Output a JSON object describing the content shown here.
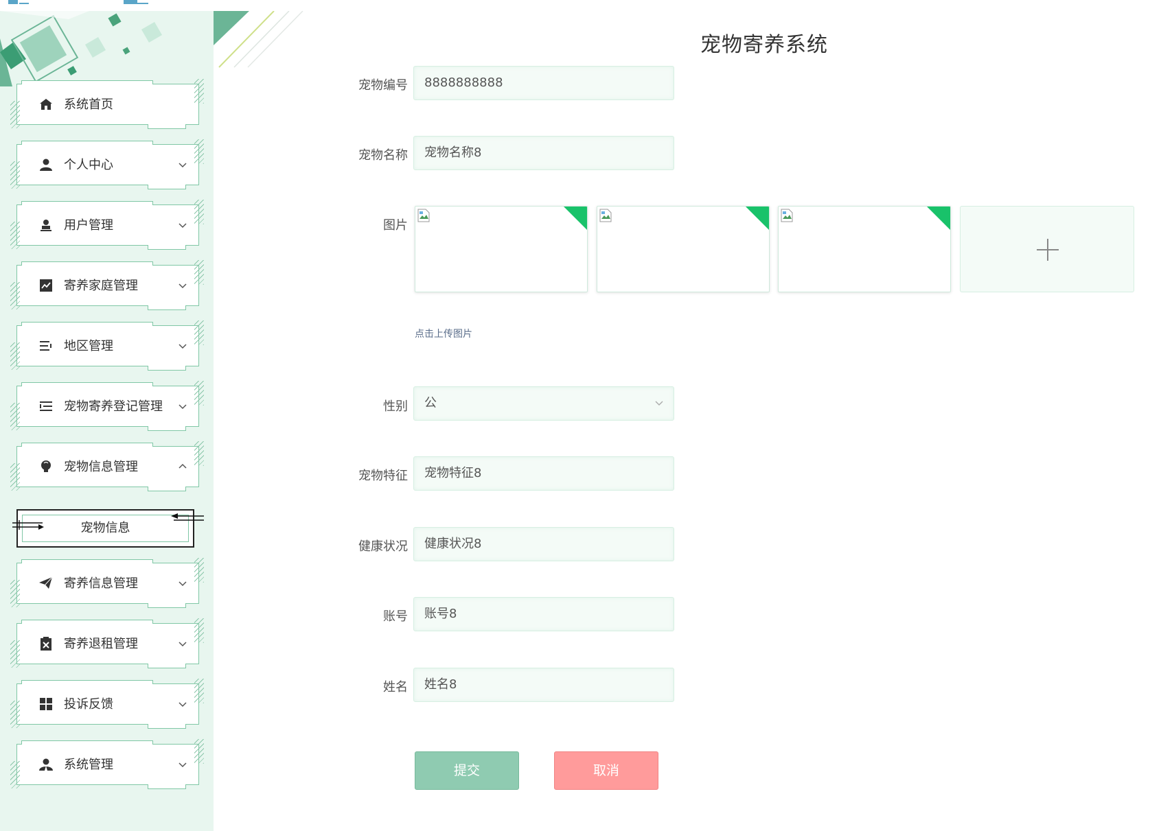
{
  "app": {
    "title": "宠物寄养系统"
  },
  "sidebar": {
    "items": [
      {
        "label": "系统首页",
        "icon": "home-icon",
        "has_chevron": false
      },
      {
        "label": "个人中心",
        "icon": "user-icon",
        "has_chevron": true
      },
      {
        "label": "用户管理",
        "icon": "user-manage-icon",
        "has_chevron": true
      },
      {
        "label": "寄养家庭管理",
        "icon": "chart-icon",
        "has_chevron": true
      },
      {
        "label": "地区管理",
        "icon": "list-indent-icon",
        "has_chevron": true
      },
      {
        "label": "宠物寄养登记管理",
        "icon": "list-outdent-icon",
        "has_chevron": true
      },
      {
        "label": "宠物信息管理",
        "icon": "lightbulb-icon",
        "has_chevron": true,
        "expanded": true
      },
      {
        "label": "寄养信息管理",
        "icon": "paper-plane-icon",
        "has_chevron": true
      },
      {
        "label": "寄养退租管理",
        "icon": "clipboard-x-icon",
        "has_chevron": true
      },
      {
        "label": "投诉反馈",
        "icon": "grid-icon",
        "has_chevron": true
      },
      {
        "label": "系统管理",
        "icon": "admin-user-icon",
        "has_chevron": true
      }
    ],
    "sub_item": {
      "label": "宠物信息"
    }
  },
  "form": {
    "pet_id": {
      "label": "宠物编号",
      "value": "8888888888"
    },
    "pet_name": {
      "label": "宠物名称",
      "value": "宠物名称8"
    },
    "images": {
      "label": "图片",
      "upload_tip": "点击上传图片",
      "upload_icon": "plus-icon"
    },
    "gender": {
      "label": "性别",
      "value": "公"
    },
    "feature": {
      "label": "宠物特征",
      "value": "宠物特征8"
    },
    "health": {
      "label": "健康状况",
      "value": "健康状况8"
    },
    "account": {
      "label": "账号",
      "value": "账号8"
    },
    "name": {
      "label": "姓名",
      "value": "姓名8"
    },
    "submit_label": "提交",
    "cancel_label": "取消"
  },
  "colors": {
    "accent": "#7fc7a5",
    "sidebar_bg": "#e8f6ef",
    "corner_badge": "#19c26a",
    "submit": "#8fcbb1",
    "cancel": "#ff9b9b"
  }
}
